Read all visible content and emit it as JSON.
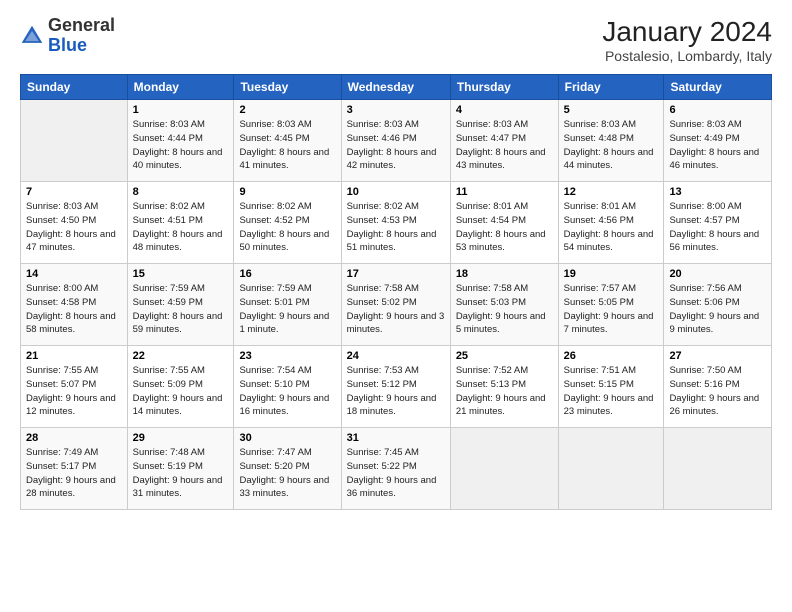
{
  "header": {
    "logo_general": "General",
    "logo_blue": "Blue",
    "month_year": "January 2024",
    "location": "Postalesio, Lombardy, Italy"
  },
  "days_of_week": [
    "Sunday",
    "Monday",
    "Tuesday",
    "Wednesday",
    "Thursday",
    "Friday",
    "Saturday"
  ],
  "weeks": [
    [
      {
        "day": "",
        "sunrise": "",
        "sunset": "",
        "daylight": ""
      },
      {
        "day": "1",
        "sunrise": "Sunrise: 8:03 AM",
        "sunset": "Sunset: 4:44 PM",
        "daylight": "Daylight: 8 hours and 40 minutes."
      },
      {
        "day": "2",
        "sunrise": "Sunrise: 8:03 AM",
        "sunset": "Sunset: 4:45 PM",
        "daylight": "Daylight: 8 hours and 41 minutes."
      },
      {
        "day": "3",
        "sunrise": "Sunrise: 8:03 AM",
        "sunset": "Sunset: 4:46 PM",
        "daylight": "Daylight: 8 hours and 42 minutes."
      },
      {
        "day": "4",
        "sunrise": "Sunrise: 8:03 AM",
        "sunset": "Sunset: 4:47 PM",
        "daylight": "Daylight: 8 hours and 43 minutes."
      },
      {
        "day": "5",
        "sunrise": "Sunrise: 8:03 AM",
        "sunset": "Sunset: 4:48 PM",
        "daylight": "Daylight: 8 hours and 44 minutes."
      },
      {
        "day": "6",
        "sunrise": "Sunrise: 8:03 AM",
        "sunset": "Sunset: 4:49 PM",
        "daylight": "Daylight: 8 hours and 46 minutes."
      }
    ],
    [
      {
        "day": "7",
        "sunrise": "Sunrise: 8:03 AM",
        "sunset": "Sunset: 4:50 PM",
        "daylight": "Daylight: 8 hours and 47 minutes."
      },
      {
        "day": "8",
        "sunrise": "Sunrise: 8:02 AM",
        "sunset": "Sunset: 4:51 PM",
        "daylight": "Daylight: 8 hours and 48 minutes."
      },
      {
        "day": "9",
        "sunrise": "Sunrise: 8:02 AM",
        "sunset": "Sunset: 4:52 PM",
        "daylight": "Daylight: 8 hours and 50 minutes."
      },
      {
        "day": "10",
        "sunrise": "Sunrise: 8:02 AM",
        "sunset": "Sunset: 4:53 PM",
        "daylight": "Daylight: 8 hours and 51 minutes."
      },
      {
        "day": "11",
        "sunrise": "Sunrise: 8:01 AM",
        "sunset": "Sunset: 4:54 PM",
        "daylight": "Daylight: 8 hours and 53 minutes."
      },
      {
        "day": "12",
        "sunrise": "Sunrise: 8:01 AM",
        "sunset": "Sunset: 4:56 PM",
        "daylight": "Daylight: 8 hours and 54 minutes."
      },
      {
        "day": "13",
        "sunrise": "Sunrise: 8:00 AM",
        "sunset": "Sunset: 4:57 PM",
        "daylight": "Daylight: 8 hours and 56 minutes."
      }
    ],
    [
      {
        "day": "14",
        "sunrise": "Sunrise: 8:00 AM",
        "sunset": "Sunset: 4:58 PM",
        "daylight": "Daylight: 8 hours and 58 minutes."
      },
      {
        "day": "15",
        "sunrise": "Sunrise: 7:59 AM",
        "sunset": "Sunset: 4:59 PM",
        "daylight": "Daylight: 8 hours and 59 minutes."
      },
      {
        "day": "16",
        "sunrise": "Sunrise: 7:59 AM",
        "sunset": "Sunset: 5:01 PM",
        "daylight": "Daylight: 9 hours and 1 minute."
      },
      {
        "day": "17",
        "sunrise": "Sunrise: 7:58 AM",
        "sunset": "Sunset: 5:02 PM",
        "daylight": "Daylight: 9 hours and 3 minutes."
      },
      {
        "day": "18",
        "sunrise": "Sunrise: 7:58 AM",
        "sunset": "Sunset: 5:03 PM",
        "daylight": "Daylight: 9 hours and 5 minutes."
      },
      {
        "day": "19",
        "sunrise": "Sunrise: 7:57 AM",
        "sunset": "Sunset: 5:05 PM",
        "daylight": "Daylight: 9 hours and 7 minutes."
      },
      {
        "day": "20",
        "sunrise": "Sunrise: 7:56 AM",
        "sunset": "Sunset: 5:06 PM",
        "daylight": "Daylight: 9 hours and 9 minutes."
      }
    ],
    [
      {
        "day": "21",
        "sunrise": "Sunrise: 7:55 AM",
        "sunset": "Sunset: 5:07 PM",
        "daylight": "Daylight: 9 hours and 12 minutes."
      },
      {
        "day": "22",
        "sunrise": "Sunrise: 7:55 AM",
        "sunset": "Sunset: 5:09 PM",
        "daylight": "Daylight: 9 hours and 14 minutes."
      },
      {
        "day": "23",
        "sunrise": "Sunrise: 7:54 AM",
        "sunset": "Sunset: 5:10 PM",
        "daylight": "Daylight: 9 hours and 16 minutes."
      },
      {
        "day": "24",
        "sunrise": "Sunrise: 7:53 AM",
        "sunset": "Sunset: 5:12 PM",
        "daylight": "Daylight: 9 hours and 18 minutes."
      },
      {
        "day": "25",
        "sunrise": "Sunrise: 7:52 AM",
        "sunset": "Sunset: 5:13 PM",
        "daylight": "Daylight: 9 hours and 21 minutes."
      },
      {
        "day": "26",
        "sunrise": "Sunrise: 7:51 AM",
        "sunset": "Sunset: 5:15 PM",
        "daylight": "Daylight: 9 hours and 23 minutes."
      },
      {
        "day": "27",
        "sunrise": "Sunrise: 7:50 AM",
        "sunset": "Sunset: 5:16 PM",
        "daylight": "Daylight: 9 hours and 26 minutes."
      }
    ],
    [
      {
        "day": "28",
        "sunrise": "Sunrise: 7:49 AM",
        "sunset": "Sunset: 5:17 PM",
        "daylight": "Daylight: 9 hours and 28 minutes."
      },
      {
        "day": "29",
        "sunrise": "Sunrise: 7:48 AM",
        "sunset": "Sunset: 5:19 PM",
        "daylight": "Daylight: 9 hours and 31 minutes."
      },
      {
        "day": "30",
        "sunrise": "Sunrise: 7:47 AM",
        "sunset": "Sunset: 5:20 PM",
        "daylight": "Daylight: 9 hours and 33 minutes."
      },
      {
        "day": "31",
        "sunrise": "Sunrise: 7:45 AM",
        "sunset": "Sunset: 5:22 PM",
        "daylight": "Daylight: 9 hours and 36 minutes."
      },
      {
        "day": "",
        "sunrise": "",
        "sunset": "",
        "daylight": ""
      },
      {
        "day": "",
        "sunrise": "",
        "sunset": "",
        "daylight": ""
      },
      {
        "day": "",
        "sunrise": "",
        "sunset": "",
        "daylight": ""
      }
    ]
  ]
}
